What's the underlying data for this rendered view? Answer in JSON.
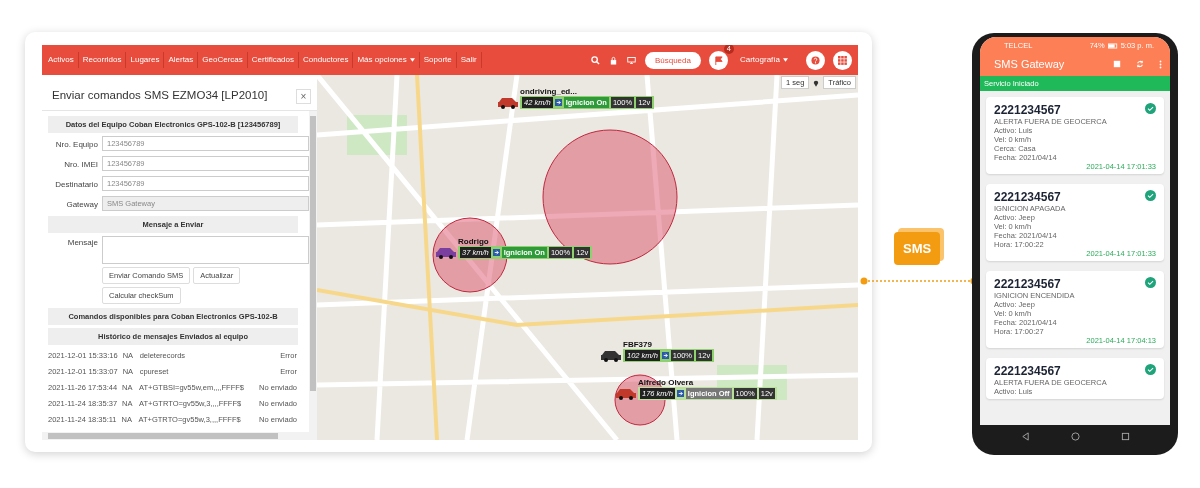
{
  "nav": {
    "items": [
      "Activos",
      "Recorridos",
      "Lugares",
      "Alertas",
      "GeoCercas",
      "Certificados",
      "Conductores",
      "Más opciones",
      "Soporte",
      "Salir"
    ],
    "search_button": "Búsqueda",
    "notifications": "4",
    "map_menu": "Cartografía"
  },
  "panel": {
    "title": "Enviar comandos SMS EZMO34 [LP2010]",
    "close": "×",
    "device_header": "Datos del Equipo Coban Electronics GPS-102-B [123456789]",
    "fields": [
      {
        "label": "Nro. Equipo",
        "value": "123456789",
        "disabled": false
      },
      {
        "label": "Nro. IMEI",
        "value": "123456789",
        "disabled": false
      },
      {
        "label": "Destinatario",
        "value": "123456789",
        "disabled": false
      },
      {
        "label": "Gateway",
        "value": "SMS Gateway",
        "disabled": true
      }
    ],
    "message_header": "Mensaje a Enviar",
    "message_label": "Mensaje",
    "buttons": [
      "Enviar Comando SMS",
      "Actualizar",
      "Calcular checkSum"
    ],
    "commands_header": "Comandos disponibles para Coban Electronics GPS-102-B",
    "history_header": "Histórico de mensajes Enviados al equipo",
    "history": [
      {
        "date": "2021-12-01 15:33:16",
        "na": "NA",
        "command": "deleterecords",
        "status": "Error"
      },
      {
        "date": "2021-12-01 15:33:07",
        "na": "NA",
        "command": "cpureset",
        "status": "Error"
      },
      {
        "date": "2021-11-26 17:53:44",
        "na": "NA",
        "command": "AT+GTBSI=gv55w,em,,,,FFFF$",
        "status": "No enviado"
      },
      {
        "date": "2021-11-24 18:35:37",
        "na": "NA",
        "command": "AT+GTRTO=gv55w,3,,,,FFFF$",
        "status": "No enviado"
      },
      {
        "date": "2021-11-24 18:35:11",
        "na": "NA",
        "command": "AT+GTRTO=gv55w,3,,,,FFFF$",
        "status": "No enviado"
      }
    ]
  },
  "map": {
    "refresh": "1 seg",
    "traffic": "Tráfico",
    "vehicles": [
      {
        "name": "ondriving_ed...",
        "speed": "42 km/h",
        "ignition": "Ignicion On",
        "ignition_on": true,
        "battery": "100%",
        "voltage": "12v"
      },
      {
        "name": "Rodrigo",
        "speed": "37 km/h",
        "ignition": "Ignicion On",
        "ignition_on": true,
        "battery": "100%",
        "voltage": "12v"
      },
      {
        "name": "FBF379",
        "speed": "102 km/h",
        "battery": "100%",
        "voltage": "12v"
      },
      {
        "name": "Alfredo Olvera",
        "speed": "176 km/h",
        "ignition": "Ignicion Off",
        "ignition_on": false,
        "battery": "100%",
        "voltage": "12v"
      }
    ]
  },
  "sms_badge": "SMS",
  "phone": {
    "carrier": "TELCEL",
    "battery": "74%",
    "time": "5:03 p. m.",
    "app_title": "SMS Gateway",
    "service_status": "Servicio Iniciado",
    "messages": [
      {
        "number": "2221234567",
        "lines": [
          "ALERTA FUERA DE GEOCERCA",
          "Activo: Luis",
          "Vel: 0 km/h",
          "Cerca: Casa",
          "Fecha: 2021/04/14"
        ],
        "timestamp": "2021-04-14 17:01:33",
        "sent": true
      },
      {
        "number": "2221234567",
        "lines": [
          "IGNICION APAGADA",
          "Activo: Jeep",
          "Vel: 0 km/h",
          "Fecha: 2021/04/14",
          "Hora: 17:00:22"
        ],
        "timestamp": "2021-04-14 17:01:33",
        "sent": true
      },
      {
        "number": "2221234567",
        "lines": [
          "IGNICION ENCENDIDA",
          "Activo: Jeep",
          "Vel: 0 km/h",
          "Fecha: 2021/04/14",
          "Hora: 17:00:27"
        ],
        "timestamp": "2021-04-14 17:04:13",
        "sent": true
      },
      {
        "number": "2221234567",
        "lines": [
          "ALERTA FUERA DE GEOCERCA",
          "Activo: Luis"
        ],
        "sent": true
      }
    ]
  }
}
